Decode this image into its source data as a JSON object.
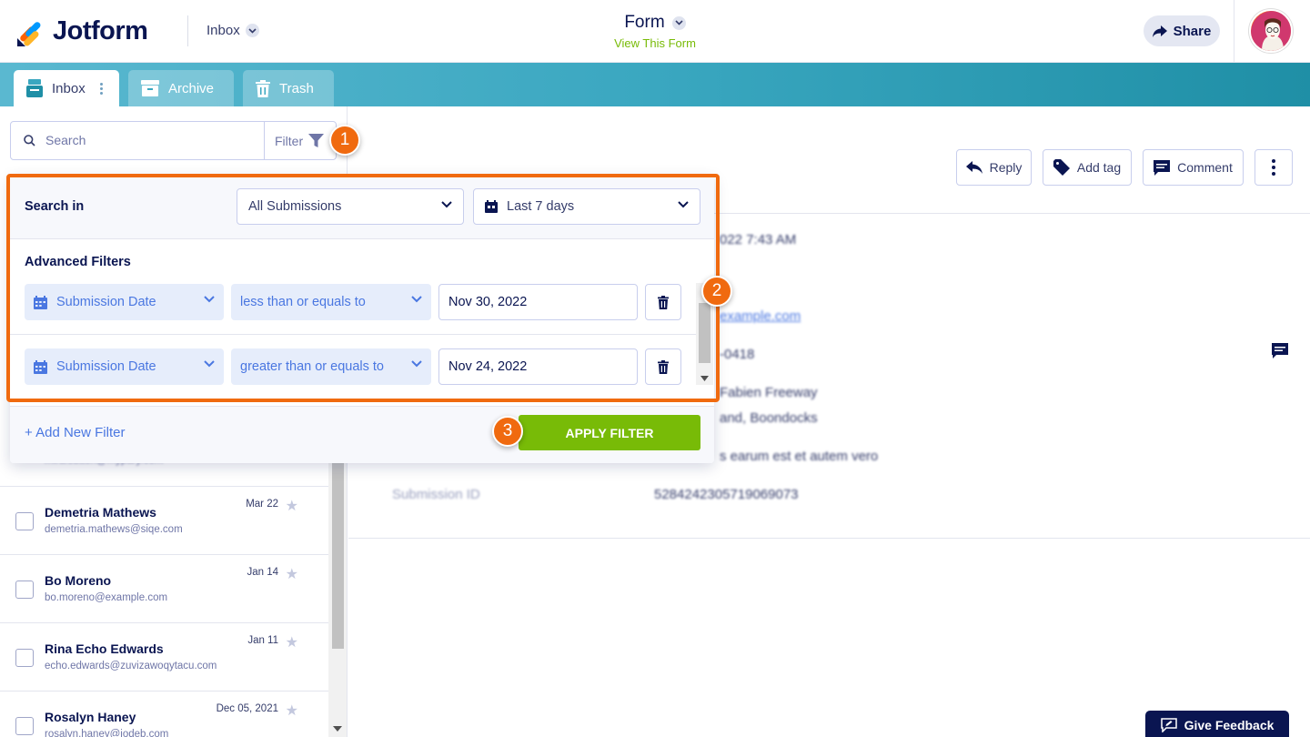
{
  "header": {
    "brand": "Jotform",
    "inbox_label": "Inbox",
    "form_title": "Form",
    "form_link": "View This Form",
    "share_label": "Share"
  },
  "tabs": [
    {
      "label": "Inbox"
    },
    {
      "label": "Archive"
    },
    {
      "label": "Trash"
    }
  ],
  "search": {
    "placeholder": "Search",
    "filter_label": "Filter"
  },
  "filter_popup": {
    "search_in_label": "Search in",
    "scope_value": "All Submissions",
    "range_value": "Last 7 days",
    "advanced_label": "Advanced Filters",
    "filters": [
      {
        "field": "Submission Date",
        "operator": "less than or equals to",
        "value": "Nov 30, 2022"
      },
      {
        "field": "Submission Date",
        "operator": "greater than or equals to",
        "value": "Nov 24, 2022"
      }
    ],
    "add_filter_label": "+ Add New Filter",
    "apply_label": "APPLY FILTER"
  },
  "badges": [
    "1",
    "2",
    "3"
  ],
  "submissions": [
    {
      "name": "Demetria Mathews",
      "email": "demetria.mathews@siqe.com",
      "date": "Mar 22"
    },
    {
      "name": "Bo Moreno",
      "email": "bo.moreno@example.com",
      "date": "Jan 14"
    },
    {
      "name": "Rina Echo Edwards",
      "email": "echo.edwards@zuvizawoqytacu.com",
      "date": "Jan 11"
    },
    {
      "name": "Rosalyn Haney",
      "email": "rosalyn.haney@iodeb.com",
      "date": "Dec 05, 2021"
    }
  ],
  "partial_email": "mira.sutton@mypary.com",
  "actions": {
    "reply": "Reply",
    "add_tag": "Add tag",
    "comment": "Comment"
  },
  "detail": {
    "date_fragment": "022 7:43 AM",
    "email_fragment": "example.com",
    "phone_fragment": "-0418",
    "address_line1": "Fabien Freeway",
    "address_line2": "and, Boondocks",
    "text_fragment": "s earum est et autem vero",
    "submission_id_label": "Submission ID",
    "submission_id_value": "5284242305719069073"
  },
  "feedback_label": "Give Feedback",
  "colors": {
    "accent_orange": "#f06a0f",
    "apply_green": "#78bb07",
    "brand_navy": "#0a1551",
    "link_blue": "#4a77e1"
  }
}
